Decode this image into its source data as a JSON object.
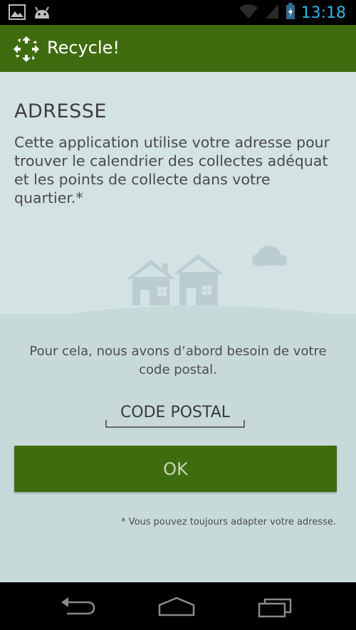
{
  "status_bar": {
    "time": "13:18",
    "icons": [
      "image-icon",
      "android-icon",
      "wifi-icon",
      "signal-icon",
      "battery-icon"
    ]
  },
  "action_bar": {
    "app_title": "Recycle!",
    "icon": "recycle-icon"
  },
  "content": {
    "heading": "ADRESSE",
    "intro": "Cette application utilise votre adresse pour trouver le calendrier des collectes adéquat et les points de collecte dans votre quartier.*",
    "need_text": "Pour cela, nous avons d’abord besoin de votre code postal.",
    "postal_placeholder": "CODE POSTAL",
    "postal_value": "",
    "ok_label": "OK",
    "footnote": "* Vous pouvez toujours adapter votre adresse."
  },
  "nav_bar": {
    "buttons": [
      "back-icon",
      "home-icon",
      "recents-icon"
    ]
  },
  "colors": {
    "primary_green": "#3f6c0f",
    "background": "#cfdedf",
    "time_blue": "#33b5e5"
  }
}
